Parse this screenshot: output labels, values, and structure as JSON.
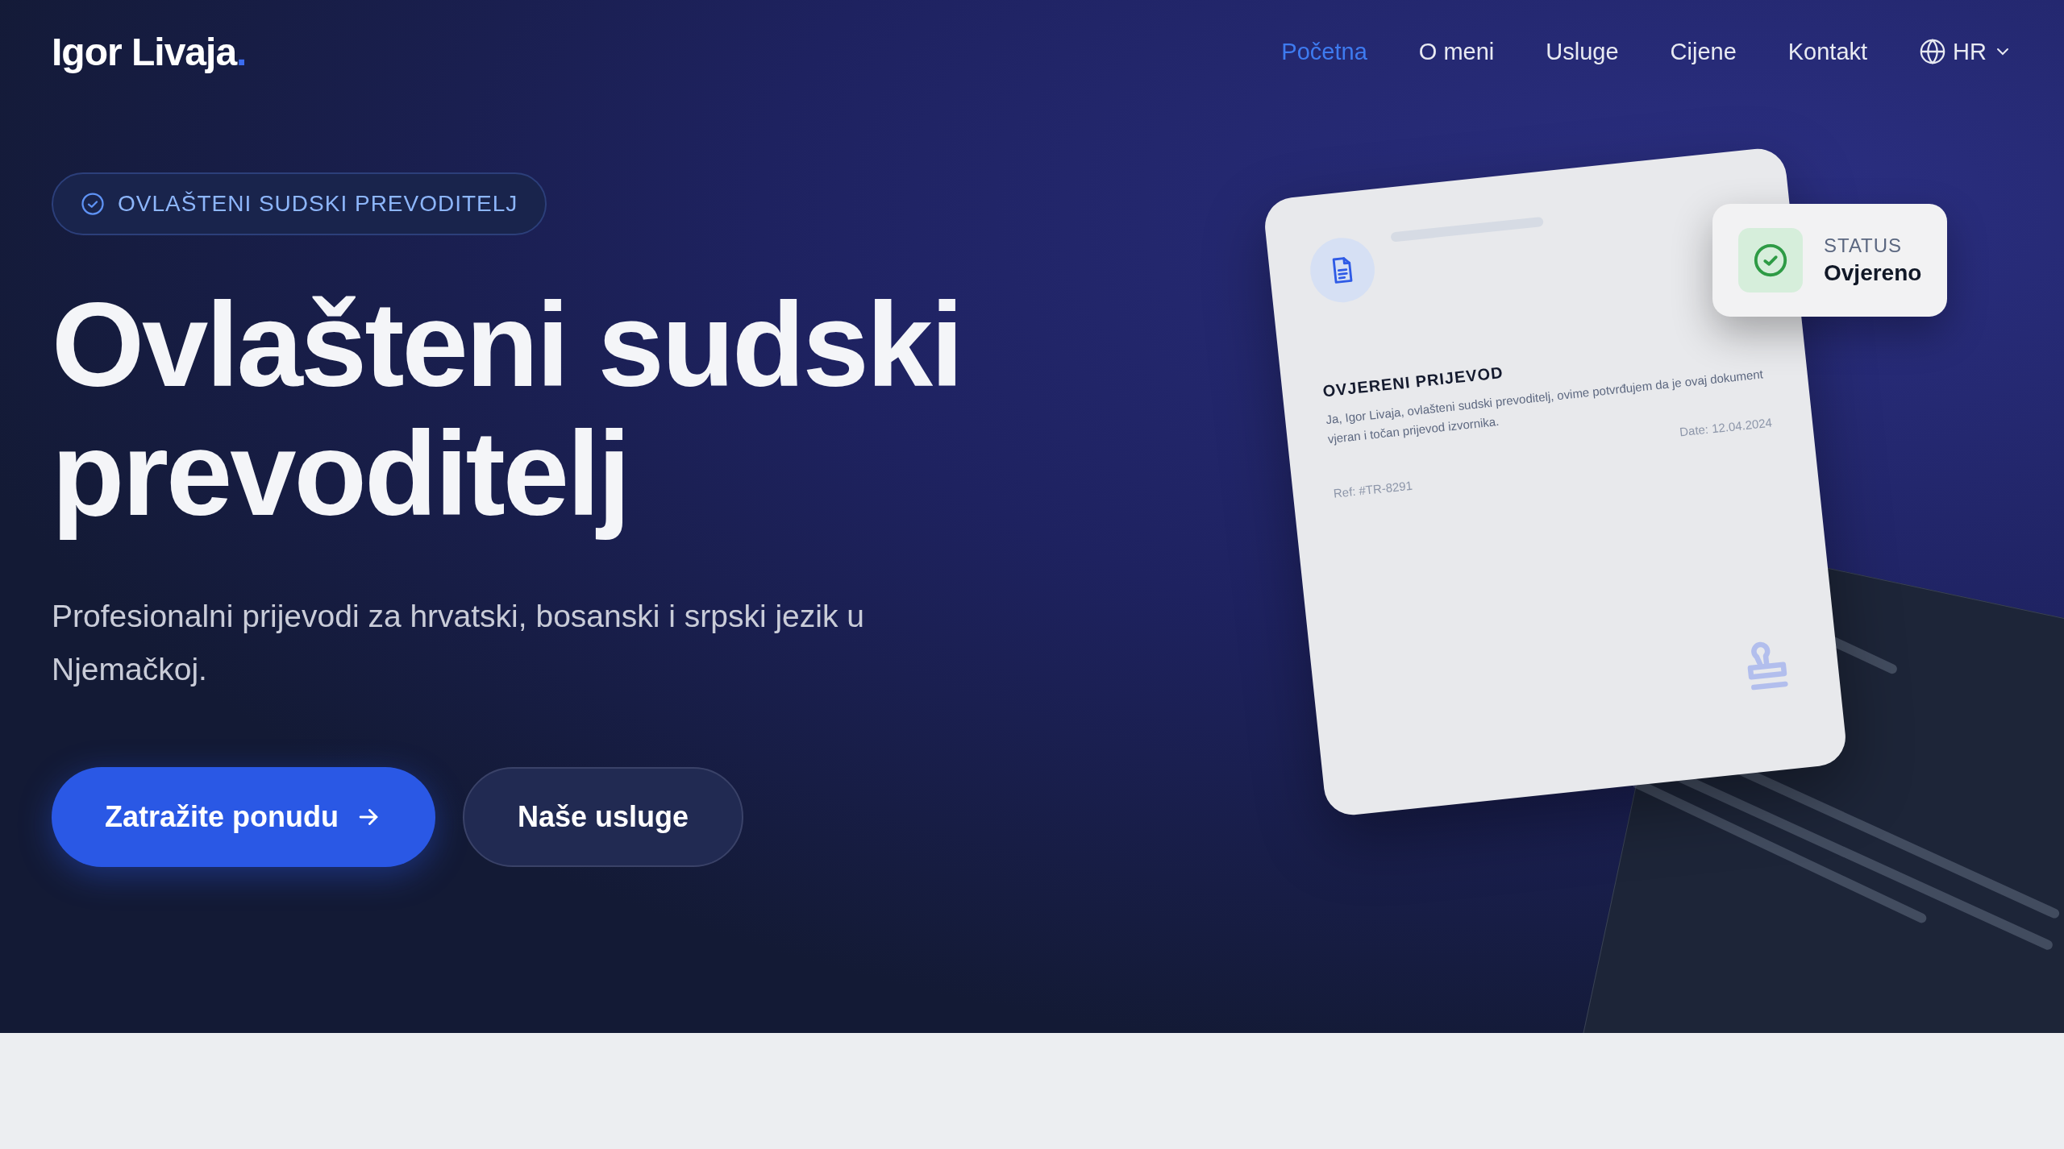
{
  "logo": {
    "name": "Igor Livaja",
    "dot": "."
  },
  "nav": {
    "items": [
      {
        "label": "Početna",
        "selected": true
      },
      {
        "label": "O meni",
        "selected": false
      },
      {
        "label": "Usluge",
        "selected": false
      },
      {
        "label": "Cijene",
        "selected": false
      },
      {
        "label": "Kontakt",
        "selected": false
      }
    ],
    "language": "HR"
  },
  "hero": {
    "badge": "OVLAŠTENI SUDSKI PREVODITELJ",
    "title_lines": [
      "Ovlašteni sudski",
      "prevoditelj"
    ],
    "subtitle": "Profesionalni prijevodi za hrvatski, bosanski i srpski jezik u Njemačkoj.",
    "buttons": [
      {
        "label": "Zatražite ponudu",
        "kind": "primary"
      },
      {
        "label": "Naše usluge",
        "kind": "secondary"
      }
    ]
  },
  "document": {
    "title": "OVJERENI PRIJEVOD",
    "text": "Ja, Igor Livaja, ovlašteni sudski prevoditelj, ovime potvrđujem da je ovaj dokument vjeran i točan prijevod izvornika.",
    "date": "Date: 12.04.2024",
    "ref": "Ref: #TR-8291"
  },
  "status": {
    "label": "STATUS",
    "value": "Ovjereno"
  }
}
